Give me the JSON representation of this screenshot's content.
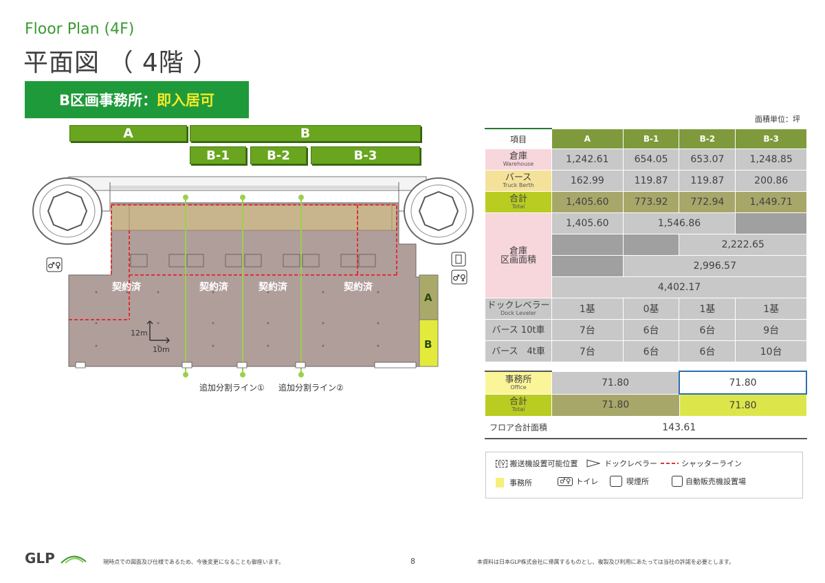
{
  "title_en": "Floor Plan (4F)",
  "title_ja": "平面図 （ 4階 ）",
  "banner": {
    "prefix": "B区画事務所：",
    "highlight": "即入居可"
  },
  "zones": {
    "a": "A",
    "b": "B",
    "b1": "B-1",
    "b2": "B-2",
    "b3": "B-3"
  },
  "plan": {
    "contracted": "契約済",
    "scale_v": "12m",
    "scale_h": "10m",
    "side_a": "A",
    "side_b": "B",
    "split_line_1": "追加分割ライン①",
    "split_line_2": "追加分割ライン②"
  },
  "unit_note": "面積単位：坪",
  "table": {
    "header": [
      "項目",
      "A",
      "B-1",
      "B-2",
      "B-3"
    ],
    "warehouse": {
      "label": "倉庫",
      "sub": "Warehouse",
      "values": [
        "1,242.61",
        "654.05",
        "653.07",
        "1,248.85"
      ]
    },
    "berth": {
      "label": "バース",
      "sub": "Truck Berth",
      "values": [
        "162.99",
        "119.87",
        "119.87",
        "200.86"
      ]
    },
    "total": {
      "label": "合計",
      "sub": "Total",
      "values": [
        "1,405.60",
        "773.92",
        "772.94",
        "1,449.71"
      ]
    },
    "block_area": {
      "label_1": "倉庫",
      "label_2": "区画面積",
      "r1_a": "1,405.60",
      "r1_b12": "1,546.86",
      "r2_b23": "2,222.65",
      "r3_b123": "2,996.57",
      "r4_all": "4,402.17"
    },
    "dock": {
      "label": "ドックレベラー",
      "sub": "Dock Leveler",
      "values": [
        "1基",
        "0基",
        "1基",
        "1基"
      ]
    },
    "berth10": {
      "label": "バース 10t車",
      "values": [
        "7台",
        "6台",
        "6台",
        "9台"
      ]
    },
    "berth4": {
      "label": "バース　4t車",
      "values": [
        "7台",
        "6台",
        "6台",
        "10台"
      ]
    }
  },
  "office_table": {
    "office": {
      "label": "事務所",
      "sub": "Office",
      "a": "71.80",
      "b": "71.80"
    },
    "total": {
      "label": "合計",
      "sub": "Total",
      "a": "71.80",
      "b": "71.80"
    },
    "floor_total": {
      "label": "フロア合計面積",
      "value": "143.61"
    }
  },
  "legend": {
    "ev_box": "EV",
    "ev": "搬送機設置可能位置",
    "dock": "ドックレベラー",
    "shutter": "シャッターライン",
    "office": "事務所",
    "toilet": "トイレ",
    "smoking": "喫煙所",
    "vending": "自動販売機設置場"
  },
  "footer": {
    "logo": "GLP",
    "disclaimer": "現時点での図面及び仕様であるため、今後変更になることも御座います。",
    "page": "8",
    "copyright": "本資料は日本GLP株式会社に帰属するものとし、複製及び利用にあたっては当社の許諾を必要とします。"
  },
  "colors": {
    "brand_green": "#1f9a3a",
    "zone_green": "#6aa51f",
    "highlight_yellow": "#f6ea2a",
    "floor": "#b09e9b",
    "shutter_red": "#e03030"
  }
}
